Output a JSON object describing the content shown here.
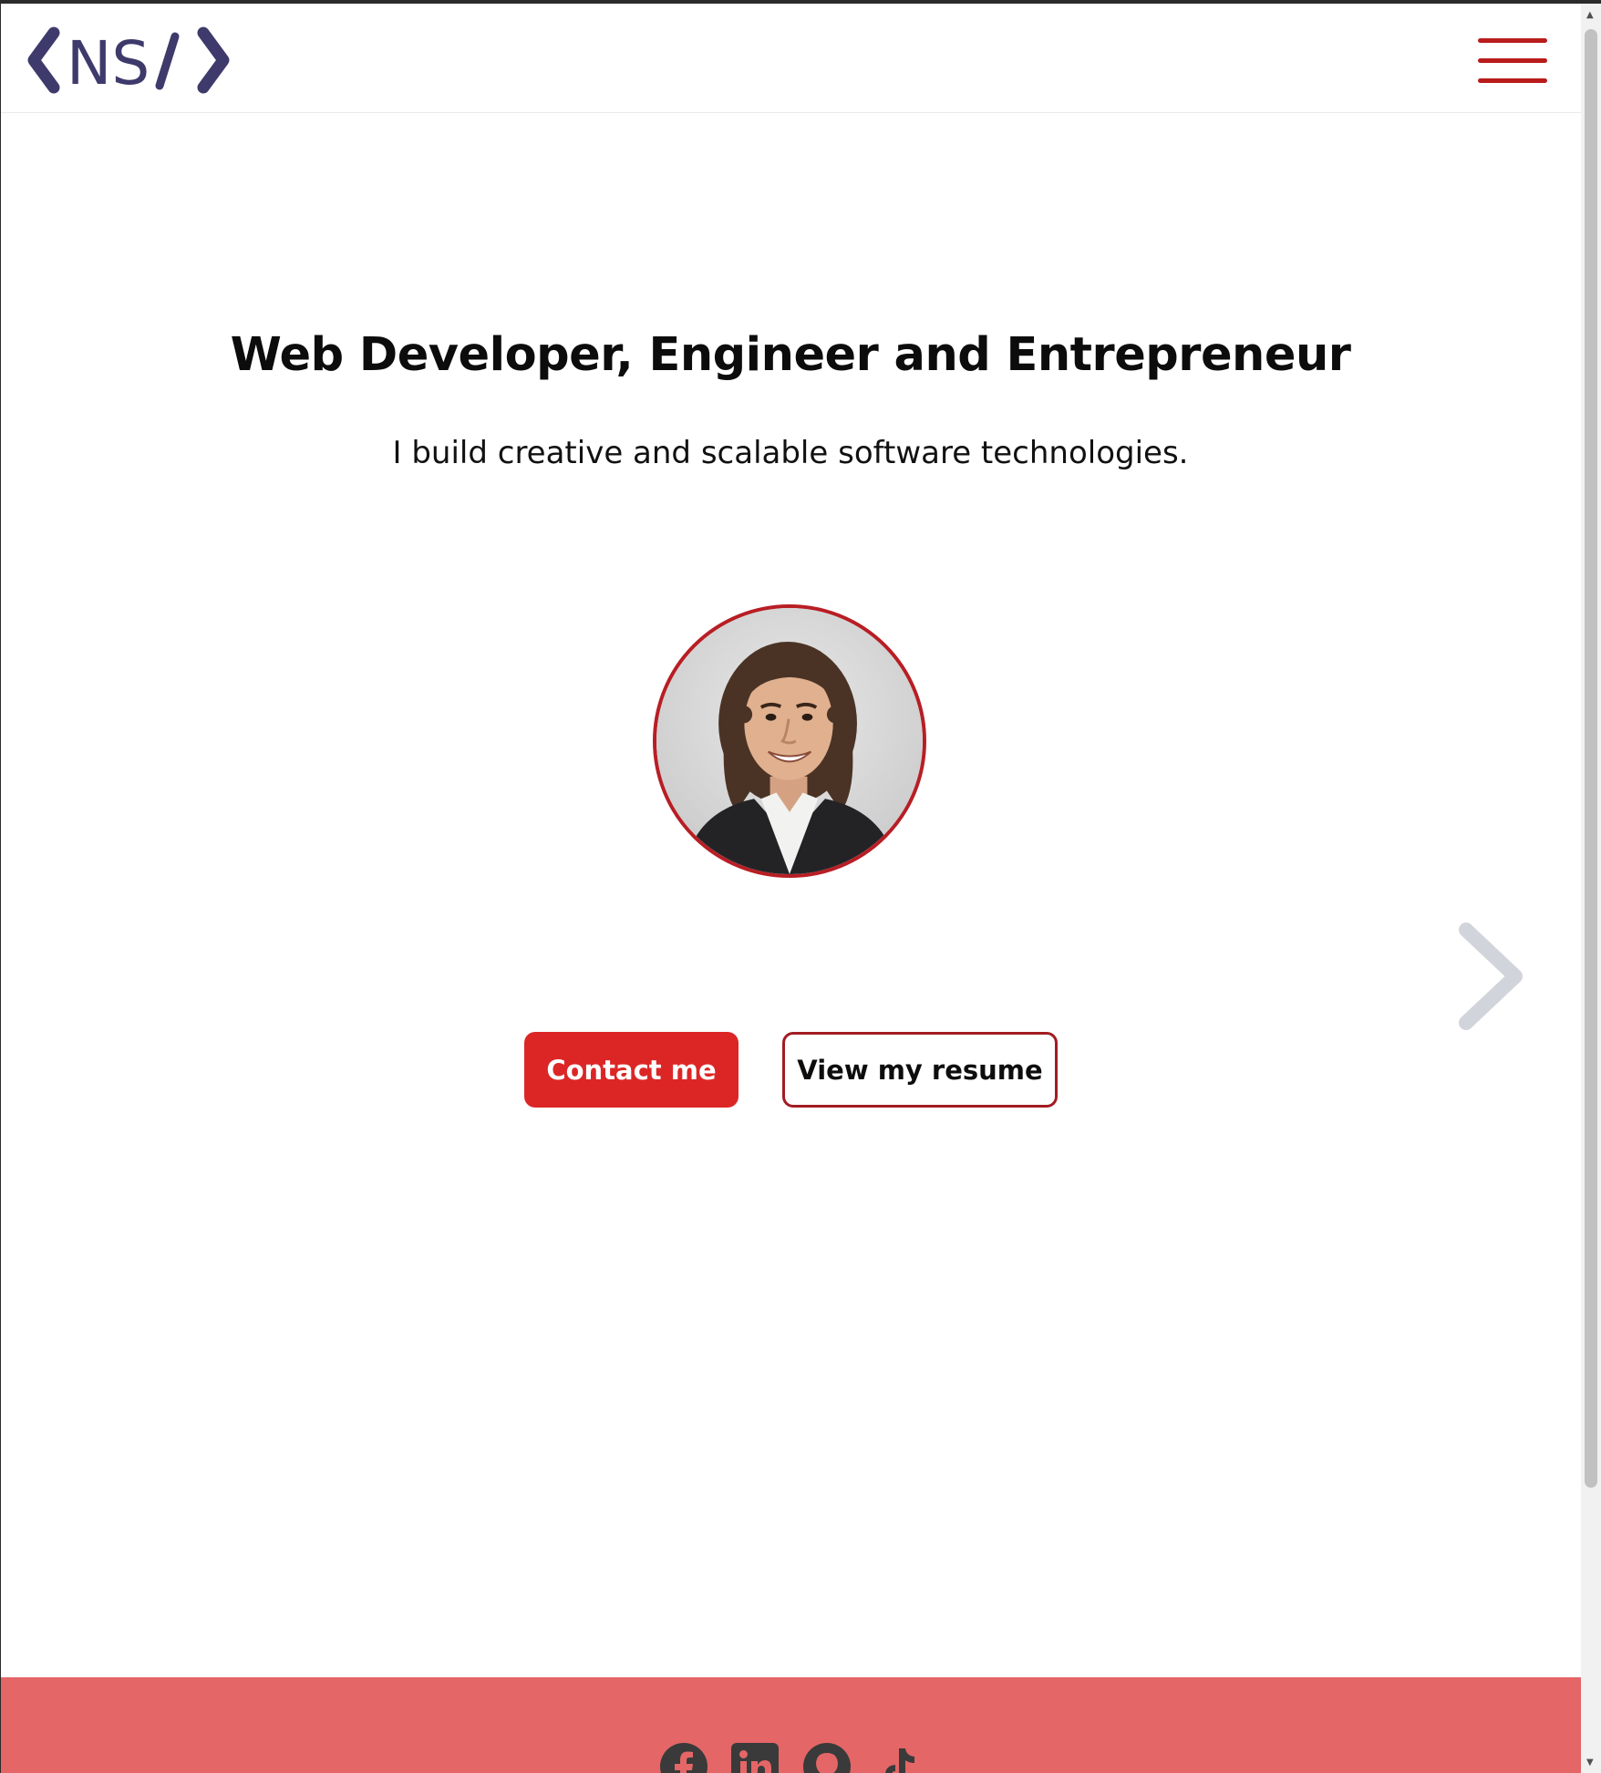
{
  "header": {
    "logo_text": "<NS/>",
    "menu_icon": "hamburger-icon"
  },
  "hero": {
    "title": "Web Developer, Engineer and Entrepreneur",
    "subtitle": "I build creative and scalable software technologies.",
    "next_icon": "chevron-right-icon"
  },
  "buttons": {
    "contact_label": "Contact me",
    "resume_label": "View my resume"
  },
  "footer": {
    "social_icons": [
      "facebook-icon",
      "linkedin-icon",
      "github-icon",
      "tiktok-icon"
    ]
  },
  "colors": {
    "brand_purple": "#3e3a6b",
    "accent_red": "#dc2626",
    "menu_red": "#b91c1c",
    "footer_bg": "#e46667",
    "chevron_gray": "#d1d5db"
  }
}
